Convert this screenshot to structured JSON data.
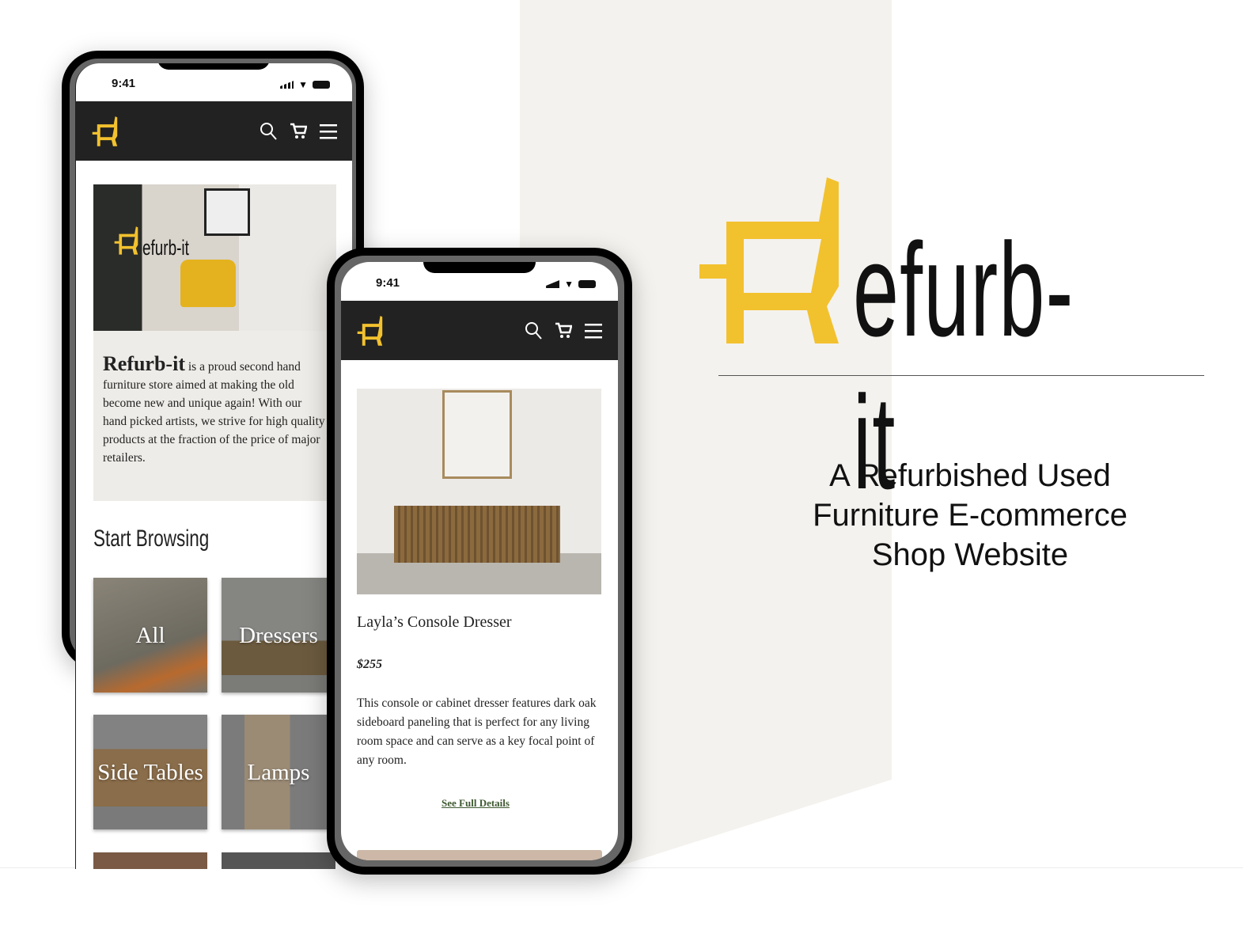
{
  "brand": {
    "name_rest": "efurb-it",
    "tagline": "A Refurbished Used Furniture E-commerce Shop Website",
    "accent": "#f2c12e"
  },
  "status_bar": {
    "time": "9:41"
  },
  "nav_icons": [
    "search-icon",
    "cart-icon",
    "menu-icon"
  ],
  "home": {
    "hero_logo_text": "efurb-it",
    "intro_title": "Refurb-it",
    "intro_text": " is a proud second hand furniture store aimed at making the old become new and unique again! With our hand picked artists, we strive for high quality products at the fraction of the price of major retailers.",
    "section_title": "Start Browsing",
    "categories": [
      {
        "label": "All"
      },
      {
        "label": "Dressers"
      },
      {
        "label": "Side Tables"
      },
      {
        "label": "Lamps"
      }
    ]
  },
  "product": {
    "title": "Layla’s Console Dresser",
    "price": "$255",
    "description": "This console or cabinet dresser features dark oak sideboard paneling that is perfect for any living room space and can serve as a key focal point of any room.",
    "link": "See Full Details"
  }
}
